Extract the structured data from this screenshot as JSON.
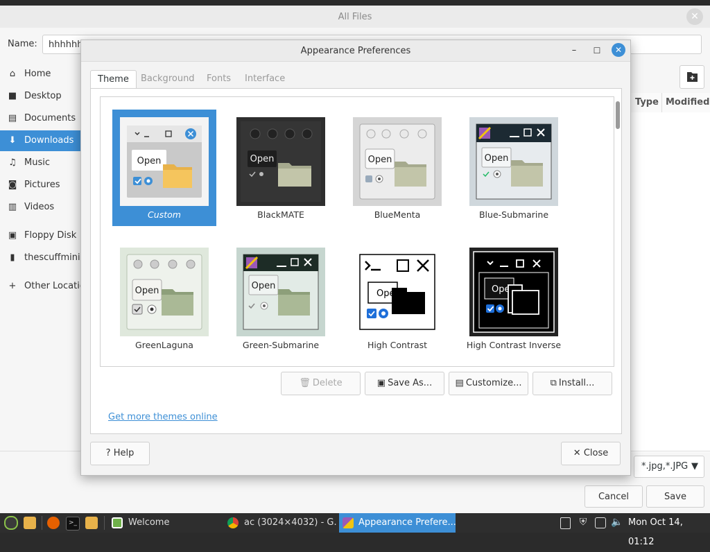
{
  "file_chooser": {
    "title": "All Files",
    "name_label": "Name:",
    "name_value": "hhhhhhh",
    "sidebar": [
      {
        "icon": "home-icon",
        "glyph": "⌂",
        "label": "Home"
      },
      {
        "icon": "desktop-icon",
        "glyph": "■",
        "label": "Desktop"
      },
      {
        "icon": "documents-icon",
        "glyph": "▤",
        "label": "Documents"
      },
      {
        "icon": "downloads-icon",
        "glyph": "⬇",
        "label": "Downloads"
      },
      {
        "icon": "music-icon",
        "glyph": "♫",
        "label": "Music"
      },
      {
        "icon": "pictures-icon",
        "glyph": "◙",
        "label": "Pictures"
      },
      {
        "icon": "videos-icon",
        "glyph": "▥",
        "label": "Videos"
      },
      {
        "icon": "floppy-icon",
        "glyph": "▣",
        "label": "Floppy Disk"
      },
      {
        "icon": "usb-drive-icon",
        "glyph": "▮",
        "label": "thescuffmini"
      },
      {
        "icon": "plus-icon",
        "glyph": "+",
        "label": "Other Locations"
      }
    ],
    "active_sidebar": "Downloads",
    "columns": [
      "Type",
      "Modified"
    ],
    "filter_value": "*.jpg,*.JPG",
    "cancel_label": "Cancel",
    "save_label": "Save"
  },
  "dialog": {
    "title": "Appearance Preferences",
    "tabs": [
      "Theme",
      "Background",
      "Fonts",
      "Interface"
    ],
    "active_tab": "Theme",
    "themes": [
      {
        "name": "Custom",
        "selected": true
      },
      {
        "name": "BlackMATE"
      },
      {
        "name": "BlueMenta"
      },
      {
        "name": "Blue-Submarine"
      },
      {
        "name": "GreenLaguna"
      },
      {
        "name": "Green-Submarine"
      },
      {
        "name": "High Contrast"
      },
      {
        "name": "High Contrast Inverse"
      }
    ],
    "thumb_open_label": "Open",
    "thumb_open_partial": "Ope",
    "buttons": {
      "delete": "Delete",
      "save_as": "Save As...",
      "customize": "Customize...",
      "install": "Install..."
    },
    "more_themes_link": "Get more themes online",
    "help_label": "Help",
    "close_label": "Close"
  },
  "taskbar": {
    "items": [
      {
        "label": "Welcome"
      },
      {
        "label": "ac (3024×4032) - G..."
      },
      {
        "label": "Appearance Prefere...",
        "active": true
      }
    ],
    "clock": "Mon Oct 14, 01:12"
  }
}
